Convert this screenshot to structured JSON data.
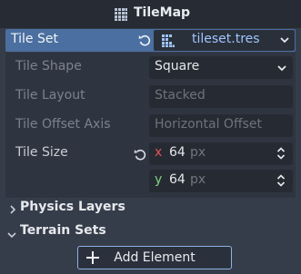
{
  "header": {
    "title": "TileMap",
    "icon": "tilemap-icon"
  },
  "tile_set": {
    "label": "Tile Set",
    "revert_icon": "revert-icon",
    "resource_icon": "tileset-resource-icon",
    "value": "tileset.tres"
  },
  "properties": {
    "tile_shape": {
      "label": "Tile Shape",
      "value": "Square"
    },
    "tile_layout": {
      "label": "Tile Layout",
      "value": "Stacked"
    },
    "tile_offset_axis": {
      "label": "Tile Offset Axis",
      "value": "Horizontal Offset"
    },
    "tile_size": {
      "label": "Tile Size",
      "x": {
        "axis": "x",
        "value": "64",
        "unit": "px"
      },
      "y": {
        "axis": "y",
        "value": "64",
        "unit": "px"
      }
    }
  },
  "sections": {
    "physics_layers": "Physics Layers",
    "terrain_sets": "Terrain Sets"
  },
  "add_element": {
    "label": "Add Element"
  },
  "colors": {
    "accent": "#4a6fa0",
    "x_axis": "#e0535a",
    "y_axis": "#7ed082",
    "link": "#9fc4ff"
  }
}
